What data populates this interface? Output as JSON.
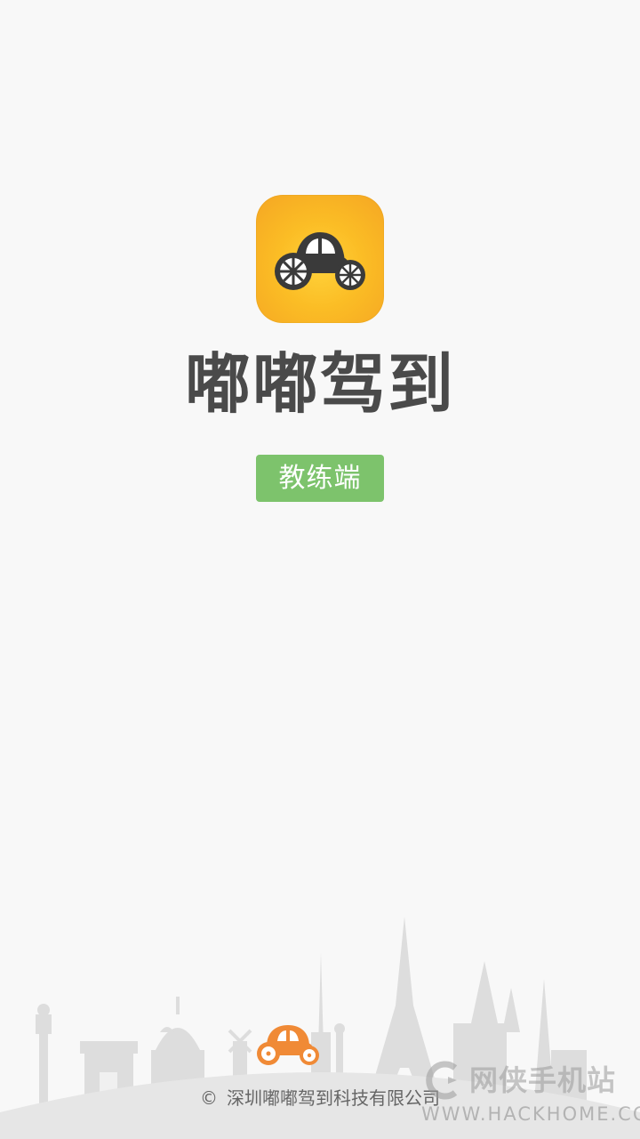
{
  "app": {
    "title": "嘟嘟驾到",
    "role_badge": "教练端",
    "icon": "car-icon",
    "brand_color": "#f7ae20",
    "badge_color": "#7dc36c"
  },
  "footer": {
    "copyright_symbol": "©",
    "company": "深圳嘟嘟驾到科技有限公司",
    "mascot_icon": "car-icon",
    "mascot_color": "#f08a36"
  },
  "watermark": {
    "name_cn": "网侠手机站",
    "url": "WWW.HACKHOME.COM"
  }
}
